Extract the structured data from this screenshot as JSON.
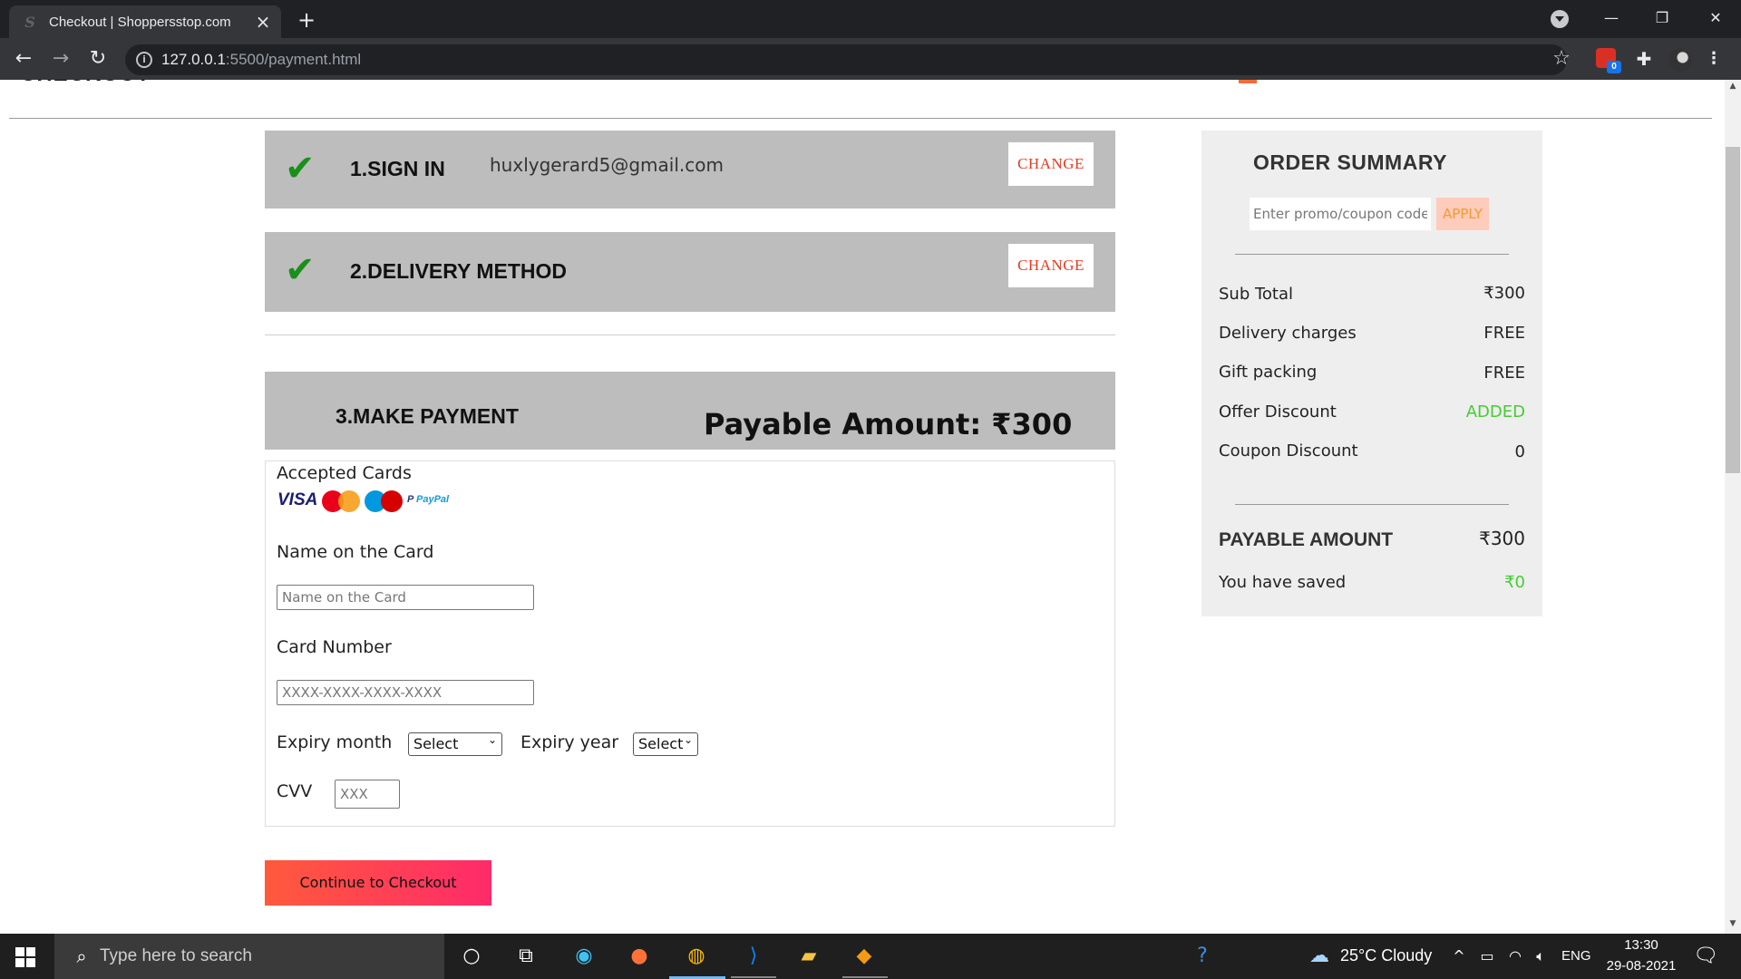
{
  "browser": {
    "tab_title": "Checkout | Shoppersstop.com",
    "tab_favicon": "S",
    "url_host": "127.0.0.1",
    "url_path": ":5500/payment.html",
    "ext_badge": "0"
  },
  "page": {
    "header_partial": "CHECKOUT",
    "sign_in": {
      "title": "1.SIGN IN",
      "email": "huxlygerard5@gmail.com",
      "change_label": "CHANGE"
    },
    "delivery": {
      "title": "2.DELIVERY METHOD",
      "change_label": "CHANGE"
    },
    "payment": {
      "title": "3.MAKE PAYMENT",
      "payable_label": "Payable Amount: ₹300",
      "accepted_cards_label": "Accepted Cards",
      "cards": [
        "VISA",
        "MasterCard",
        "Maestro",
        "PayPal"
      ],
      "name_label": "Name on the Card",
      "name_placeholder": "Name on the Card",
      "name_value": "",
      "card_number_label": "Card Number",
      "card_number_placeholder": "XXXX-XXXX-XXXX-XXXX",
      "card_number_value": "",
      "expiry_month_label": "Expiry month",
      "expiry_month_value": "Select",
      "expiry_year_label": "Expiry year",
      "expiry_year_value": "Select",
      "cvv_label": "CVV",
      "cvv_placeholder": "XXX",
      "cvv_value": ""
    },
    "continue_label": "Continue to Checkout"
  },
  "summary": {
    "title": "ORDER SUMMARY",
    "promo_placeholder": "Enter promo/coupon code",
    "promo_value": "",
    "apply_label": "APPLY",
    "rows": [
      {
        "label": "Sub Total",
        "value": "₹300",
        "color": "#222222"
      },
      {
        "label": "Delivery charges",
        "value": "FREE",
        "color": "#222222"
      },
      {
        "label": "Gift packing",
        "value": "FREE",
        "color": "#222222"
      },
      {
        "label": "Offer Discount",
        "value": "ADDED",
        "color": "#44cc33"
      },
      {
        "label": "Coupon Discount",
        "value": "0",
        "color": "#222222"
      }
    ],
    "payable_label": "PAYABLE AMOUNT",
    "payable_value": "₹300",
    "saved_label": "You have saved",
    "saved_value": "₹0",
    "saved_color": "#44cc33"
  },
  "taskbar": {
    "search_placeholder": "Type here to search",
    "weather": "25°C  Cloudy",
    "language": "ENG",
    "time": "13:30",
    "date": "29-08-2021"
  },
  "colors": {
    "accent_red": "#e53b1f",
    "check_green": "#1a8f1a",
    "step_gray": "#bdbdbd",
    "button_gradient_start": "#ff5a3c",
    "button_gradient_end": "#ff2a6a"
  }
}
